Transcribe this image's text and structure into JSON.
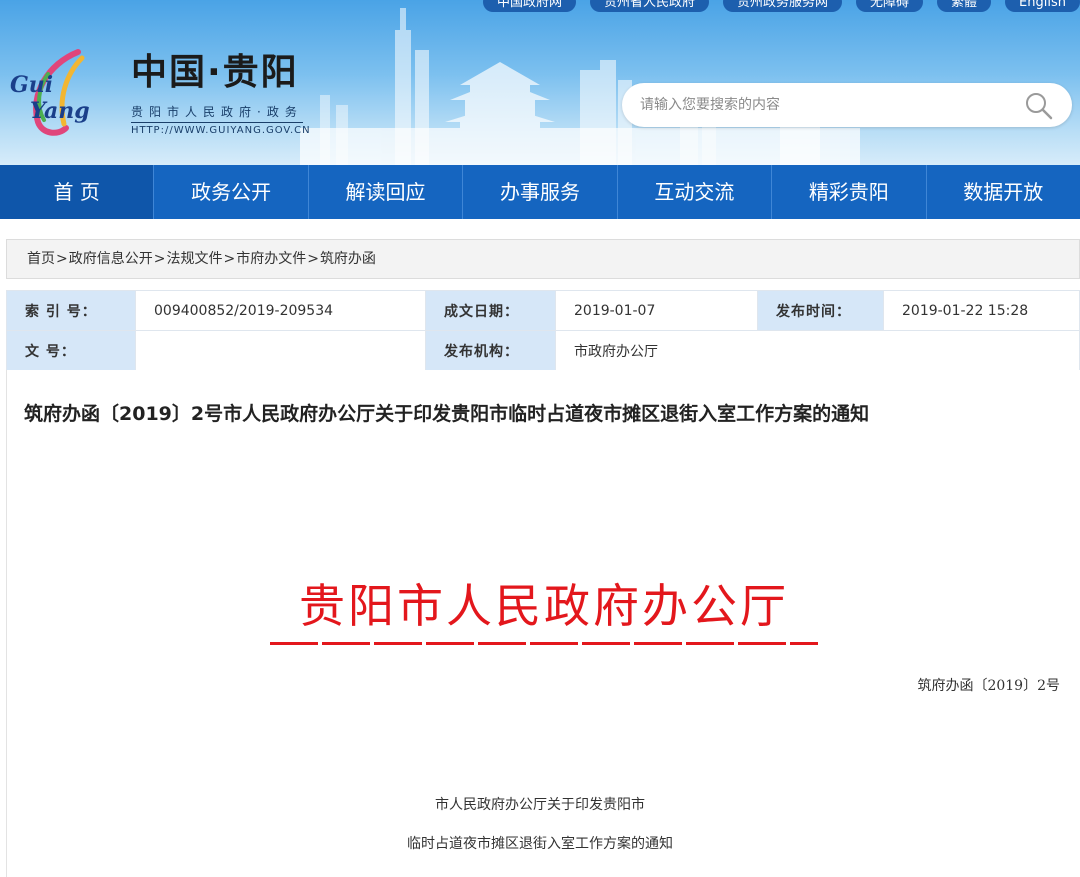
{
  "header": {
    "top_links": [
      "中国政府网",
      "贵州省人民政府",
      "贵州政务服务网",
      "无障碍",
      "繁體",
      "English"
    ],
    "logo_text": "Gui Yang",
    "site_title": "中国·贵阳",
    "site_subtitle": "贵阳市人民政府·政务",
    "site_url": "HTTP://WWW.GUIYANG.GOV.CN",
    "search_placeholder": "请输入您要搜索的内容",
    "search_icon": "search-icon",
    "colors": {
      "header_top": "#4aa3e6",
      "nav_bg": "#1565c0"
    }
  },
  "nav": {
    "items": [
      "首 页",
      "政务公开",
      "解读回应",
      "办事服务",
      "互动交流",
      "精彩贵阳",
      "数据开放"
    ]
  },
  "breadcrumb": [
    "首页",
    "政府信息公开",
    "法规文件",
    "市府办文件",
    "筑府办函"
  ],
  "breadcrumb_separator": ">",
  "meta": {
    "index_label": "索 引 号：",
    "index_value": "009400852/2019-209534",
    "date_label": "成文日期：",
    "date_value": "2019-01-07",
    "publish_label": "发布时间：",
    "publish_value": "2019-01-22 15:28",
    "docno_label": "文    号：",
    "docno_value": "",
    "org_label": "发布机构：",
    "org_value": "市政府办公厅"
  },
  "document": {
    "title": "筑府办函〔2019〕2号市人民政府办公厅关于印发贵阳市临时占道夜市摊区退街入室工作方案的通知",
    "org_header": "贵阳市人民政府办公厅",
    "doc_number": "筑府办函〔2019〕2号",
    "subtitle_line1": "市人民政府办公厅关于印发贵阳市",
    "subtitle_line2": "临时占道夜市摊区退街入室工作方案的通知",
    "colors": {
      "red_header": "#e3171c"
    }
  }
}
